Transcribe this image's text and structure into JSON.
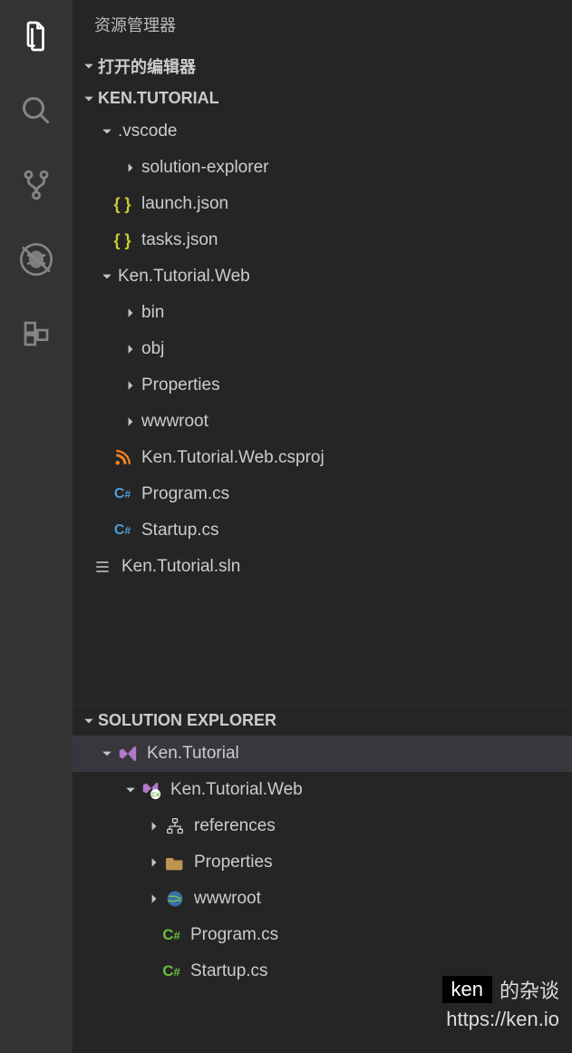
{
  "sidebar": {
    "title": "资源管理器"
  },
  "sections": {
    "openEditors": {
      "label": "打开的编辑器"
    },
    "project": {
      "label": "KEN.TUTORIAL"
    },
    "solutionExplorer": {
      "label": "SOLUTION EXPLORER"
    }
  },
  "tree": {
    "vscode": {
      "label": ".vscode"
    },
    "solutionExplorerFolder": {
      "label": "solution-explorer"
    },
    "launchJson": {
      "label": "launch.json"
    },
    "tasksJson": {
      "label": "tasks.json"
    },
    "kenTutorialWeb": {
      "label": "Ken.Tutorial.Web"
    },
    "bin": {
      "label": "bin"
    },
    "obj": {
      "label": "obj"
    },
    "properties": {
      "label": "Properties"
    },
    "wwwroot": {
      "label": "wwwroot"
    },
    "csproj": {
      "label": "Ken.Tutorial.Web.csproj"
    },
    "programCs": {
      "label": "Program.cs"
    },
    "startupCs": {
      "label": "Startup.cs"
    },
    "sln": {
      "label": "Ken.Tutorial.sln"
    }
  },
  "solution": {
    "root": {
      "label": "Ken.Tutorial"
    },
    "webProj": {
      "label": "Ken.Tutorial.Web"
    },
    "references": {
      "label": "references"
    },
    "properties": {
      "label": "Properties"
    },
    "wwwroot": {
      "label": "wwwroot"
    },
    "programCs": {
      "label": "Program.cs"
    },
    "startupCs": {
      "label": "Startup.cs"
    }
  },
  "watermark": {
    "box": "ken",
    "suffix": "的杂谈",
    "url": "https://ken.io"
  },
  "colors": {
    "jsonBraces": "#cccc33",
    "csIcon": "#4e9fd6",
    "csharpGreen": "#6cbb3c",
    "rssOrange": "#f58220",
    "vsPurple": "#9b4f96",
    "folderBrown": "#c09553"
  }
}
